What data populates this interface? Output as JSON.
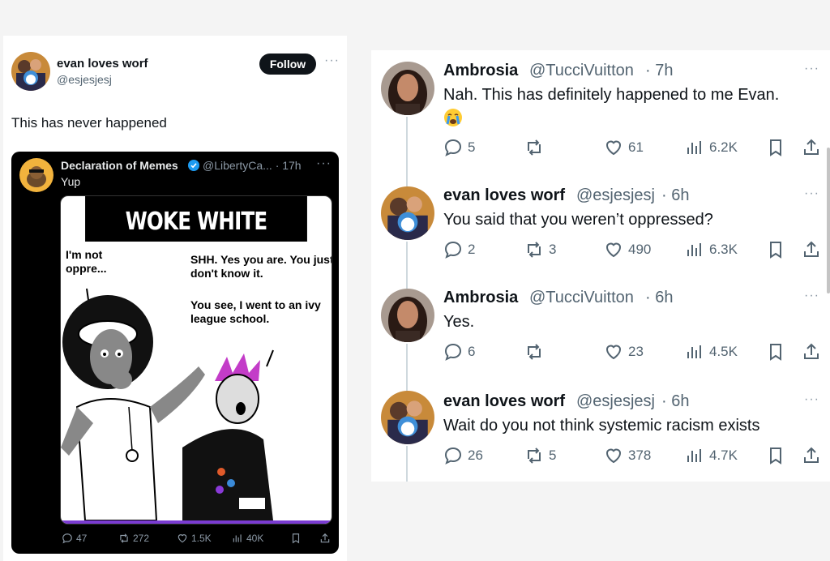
{
  "left": {
    "author_name": "evan loves worf",
    "author_handle": "@esjesjesj",
    "follow_label": "Follow",
    "more_label": "···",
    "text": "This has never happened",
    "quoted": {
      "author_name": "Declaration of Memes",
      "author_handle": "@LibertyCa... · 17h",
      "more_label": "···",
      "text": "Yup",
      "meme": {
        "title": "WOKE WHITE LIBERALS",
        "left_caption": "I'm not\noppre...",
        "right_caption_1": "SHH. Yes you are. You just don't know it.",
        "right_caption_2": "You see, I went to an ivy league school."
      },
      "actions": {
        "replies": "47",
        "reposts": "272",
        "likes": "1.5K",
        "views": "40K"
      }
    }
  },
  "thread": [
    {
      "name": "Ambrosia",
      "handle": "@TucciVuitton",
      "time": "· 7h",
      "text": "Nah. This has definitely happened to me Evan.",
      "emoji": "crying-face",
      "replies": "5",
      "reposts": "",
      "likes": "61",
      "views": "6.2K"
    },
    {
      "name": "evan loves worf",
      "handle": "@esjesjesj",
      "time": "· 6h",
      "text": "You said that you weren’t oppressed?",
      "replies": "2",
      "reposts": "3",
      "likes": "490",
      "views": "6.3K"
    },
    {
      "name": "Ambrosia",
      "handle": "@TucciVuitton",
      "time": "· 6h",
      "text": "Yes.",
      "replies": "6",
      "reposts": "",
      "likes": "23",
      "views": "4.5K"
    },
    {
      "name": "evan loves worf",
      "handle": "@esjesjesj",
      "time": "· 6h",
      "text": "Wait do you not think systemic racism exists",
      "replies": "26",
      "reposts": "5",
      "likes": "378",
      "views": "4.7K"
    }
  ],
  "more_label": "···",
  "colors": {
    "accent": "#1d9bf0",
    "text": "#0f1419",
    "muted": "#536471"
  }
}
